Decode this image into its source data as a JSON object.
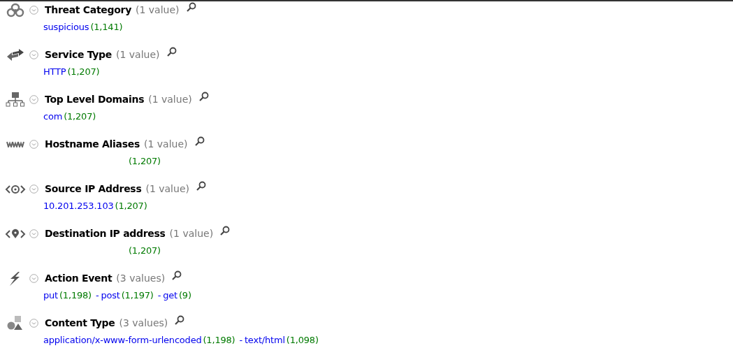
{
  "facets": [
    {
      "title": "Threat Category",
      "count_label": "(1 value)",
      "values": [
        {
          "text": "suspicious",
          "count": "(1,141)"
        }
      ]
    },
    {
      "title": "Service Type",
      "count_label": "(1 value)",
      "values": [
        {
          "text": "HTTP",
          "count": "(1,207)"
        }
      ]
    },
    {
      "title": "Top Level Domains",
      "count_label": "(1 value)",
      "values": [
        {
          "text": "com",
          "count": "(1,207)"
        }
      ]
    },
    {
      "title": "Hostname Aliases",
      "count_label": "(1 value)",
      "values": [
        {
          "count": "(1,207)"
        }
      ]
    },
    {
      "title": "Source IP Address",
      "count_label": "(1 value)",
      "values": [
        {
          "text": "10.201.253.103",
          "count": "(1,207)"
        }
      ]
    },
    {
      "title": "Destination IP address",
      "count_label": "(1 value)",
      "values": [
        {
          "count": "(1,207)"
        }
      ]
    },
    {
      "title": "Action Event",
      "count_label": "(3 values)",
      "values": [
        {
          "text": "put",
          "count": "(1,198)"
        },
        {
          "separator": "-",
          "text": "post",
          "count": "(1,197)"
        },
        {
          "separator": "-",
          "text": "get",
          "count": "(9)"
        }
      ]
    },
    {
      "title": "Content Type",
      "count_label": "(3 values)",
      "values": [
        {
          "text": "application/x-www-form-urlencoded",
          "count": "(1,198)"
        },
        {
          "separator": "-",
          "text": "text/html",
          "count": "(1,098)"
        }
      ]
    }
  ]
}
